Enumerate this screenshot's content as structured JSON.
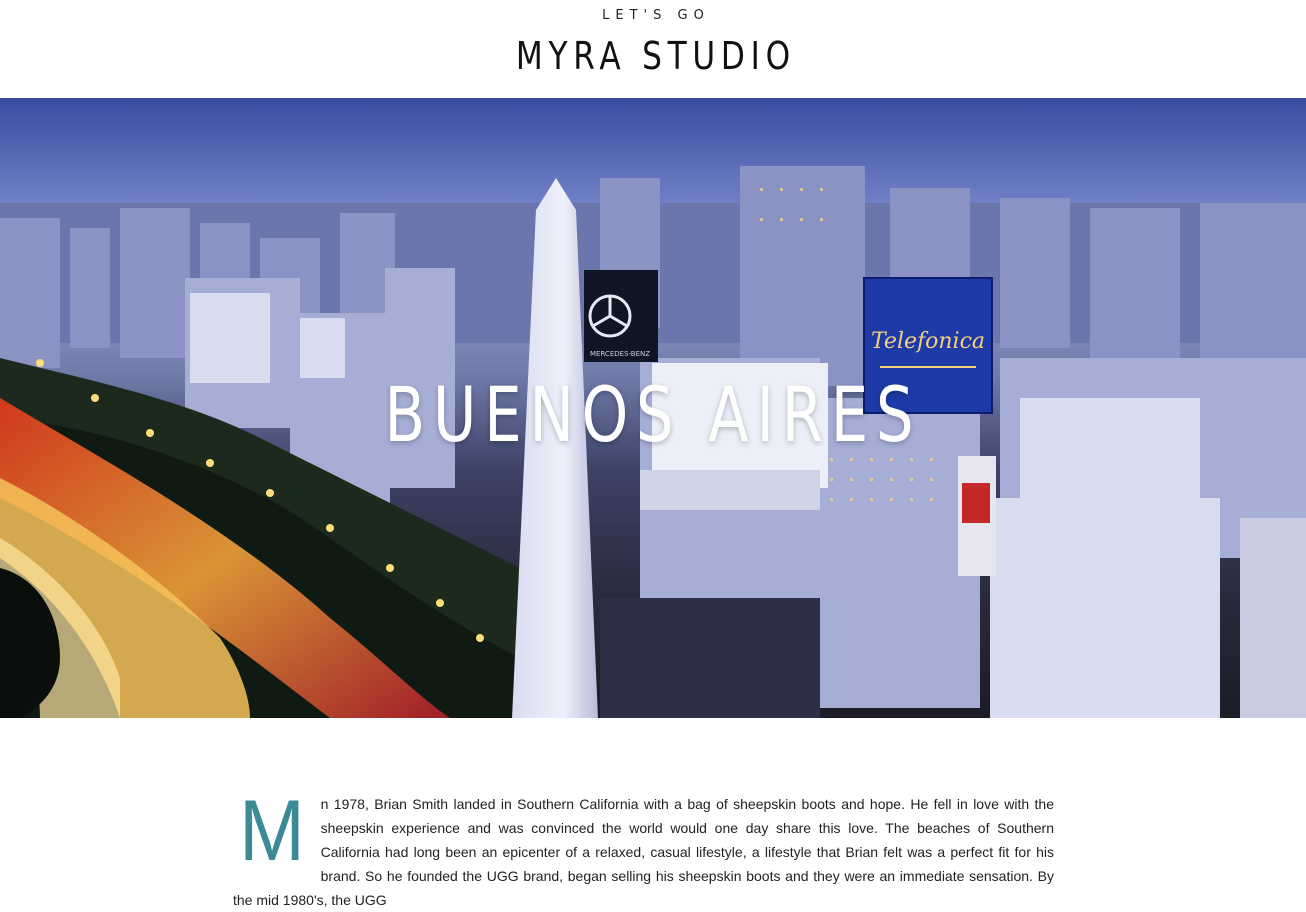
{
  "header": {
    "tagline": "LET'S GO",
    "brand": "MYRA STUDIO"
  },
  "hero": {
    "title": "BUENOS AIRES",
    "image": "buenos-aires-obelisk-night-cityscape",
    "signs": {
      "telefonica": "Telefonica",
      "mercedes": "MERCEDES-BENZ"
    }
  },
  "article": {
    "drop_cap": "M",
    "text": "n 1978, Brian Smith landed in Southern California with a bag of sheepskin boots and hope. He fell in love with the sheepskin experience and was convinced the world would one day share this love. The beaches of Southern California had long been an epicenter of a relaxed, casual lifestyle, a lifestyle that Brian felt was a perfect fit for his brand. So he founded the UGG brand, began selling his sheepskin boots and they were an immediate sensation. By the mid 1980's, the UGG"
  },
  "colors": {
    "drop_cap": "#3b8a96",
    "sky": "#4a5db0",
    "text": "#222222"
  }
}
